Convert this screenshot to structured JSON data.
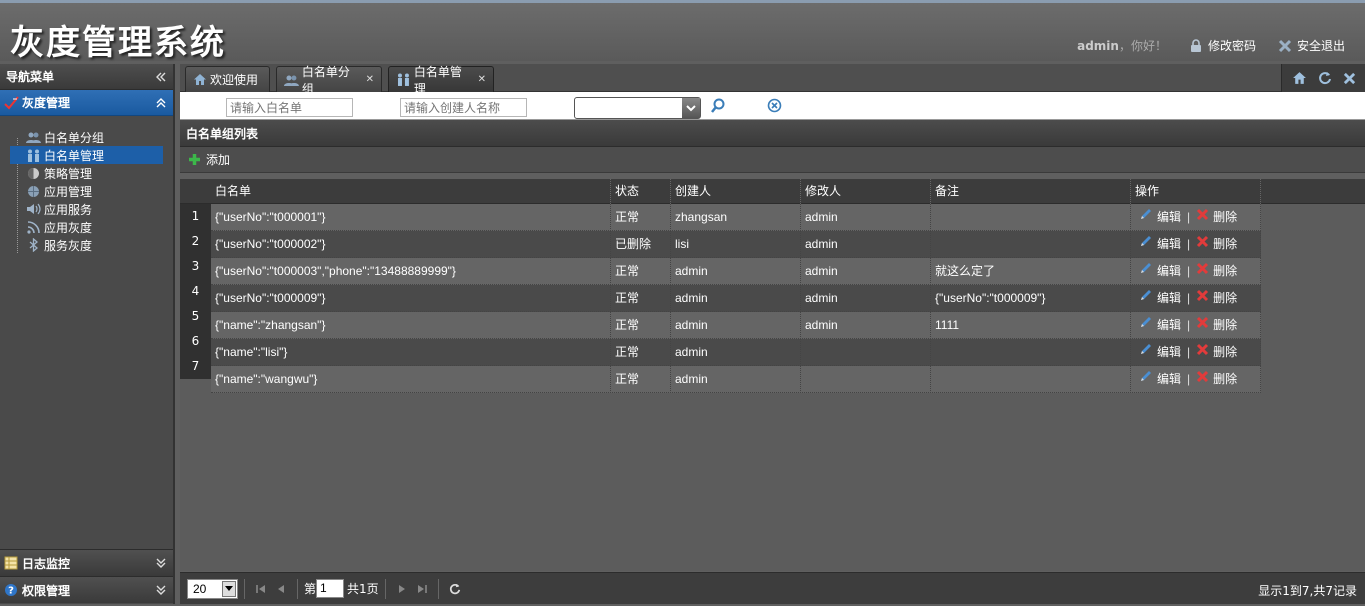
{
  "app": {
    "title": "灰度管理系统",
    "user": "admin",
    "greeting": "，你好！",
    "change_password": "修改密码",
    "logout": "安全退出"
  },
  "sidebar": {
    "header": "导航菜单",
    "active_group": "灰度管理",
    "items": [
      {
        "label": "白名单分组",
        "icon": "users-icon",
        "selected": false
      },
      {
        "label": "白名单管理",
        "icon": "people-icon",
        "selected": true
      },
      {
        "label": "策略管理",
        "icon": "half-circle-icon",
        "selected": false
      },
      {
        "label": "应用管理",
        "icon": "globe-icon",
        "selected": false
      },
      {
        "label": "应用服务",
        "icon": "speaker-icon",
        "selected": false
      },
      {
        "label": "应用灰度",
        "icon": "rss-icon",
        "selected": false
      },
      {
        "label": "服务灰度",
        "icon": "bluetooth-icon",
        "selected": false
      }
    ],
    "bottom_groups": [
      "日志监控",
      "权限管理"
    ]
  },
  "tabs": [
    {
      "label": "欢迎使用",
      "closable": false
    },
    {
      "label": "白名单分组",
      "closable": true
    },
    {
      "label": "白名单管理",
      "closable": true,
      "active": true
    }
  ],
  "search": {
    "whitelist_placeholder": "请输入白名单",
    "creator_placeholder": "请输入创建人名称",
    "status_value": ""
  },
  "grid": {
    "title": "白名单组列表",
    "add_label": "添加",
    "columns": [
      "白名单",
      "状态",
      "创建人",
      "修改人",
      "备注",
      "操作"
    ],
    "edit_label": "编辑",
    "delete_label": "删除",
    "op_separator": "|",
    "rows": [
      {
        "num": "1",
        "whitelist": "{\"userNo\":\"t000001\"}",
        "status": "正常",
        "creator": "zhangsan",
        "modifier": "admin",
        "remark": ""
      },
      {
        "num": "2",
        "whitelist": "{\"userNo\":\"t000002\"}",
        "status": "已删除",
        "creator": "lisi",
        "modifier": "admin",
        "remark": ""
      },
      {
        "num": "3",
        "whitelist": "{\"userNo\":\"t000003\",\"phone\":\"13488889999\"}",
        "status": "正常",
        "creator": "admin",
        "modifier": "admin",
        "remark": "就这么定了"
      },
      {
        "num": "4",
        "whitelist": "{\"userNo\":\"t000009\"}",
        "status": "正常",
        "creator": "admin",
        "modifier": "admin",
        "remark": "{\"userNo\":\"t000009\"}"
      },
      {
        "num": "5",
        "whitelist": "{\"name\":\"zhangsan\"}",
        "status": "正常",
        "creator": "admin",
        "modifier": "admin",
        "remark": "1111"
      },
      {
        "num": "6",
        "whitelist": "{\"name\":\"lisi\"}",
        "status": "正常",
        "creator": "admin",
        "modifier": "",
        "remark": ""
      },
      {
        "num": "7",
        "whitelist": "{\"name\":\"wangwu\"}",
        "status": "正常",
        "creator": "admin",
        "modifier": "",
        "remark": ""
      }
    ]
  },
  "pager": {
    "page_size": "20",
    "page_prefix": "第",
    "page_number": "1",
    "total_pages": "共1页",
    "info": "显示1到7,共7记录"
  }
}
